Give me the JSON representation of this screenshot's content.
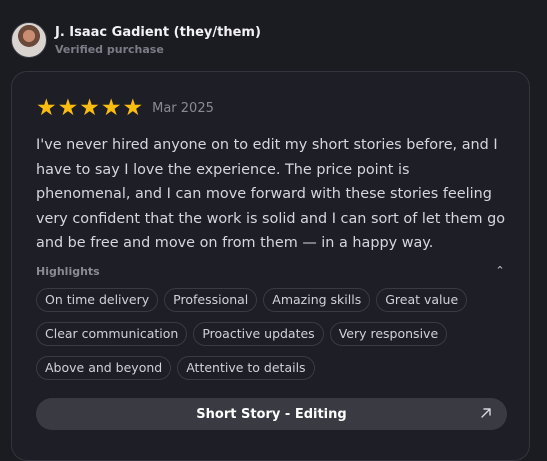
{
  "reviewer": {
    "name": "J. Isaac Gadient (they/them)",
    "status": "Verified purchase",
    "avatar_icon": "person-photo"
  },
  "review": {
    "rating": 5,
    "rating_max": 5,
    "star_glyph": "★",
    "star_color": "#fbbc12",
    "date": "Mar 2025",
    "text": "I've never hired anyone on to edit my short stories before, and I have to say I love the experience. The price point is phenomenal, and I can move forward with these stories feeling very confident that the work is solid and I can sort of let them go and be free and move on from them — in a happy way."
  },
  "highlights": {
    "label": "Highlights",
    "toggle_icon": "chevron-up-icon",
    "toggle_glyph": "⌃",
    "rows": [
      [
        "On time delivery",
        "Professional",
        "Amazing skills",
        "Great value"
      ],
      [
        "Clear communication",
        "Proactive updates",
        "Very responsive"
      ],
      [
        "Above and beyond",
        "Attentive to details"
      ]
    ]
  },
  "service": {
    "label": "Short Story - Editing",
    "icon": "arrow-up-right-icon"
  }
}
